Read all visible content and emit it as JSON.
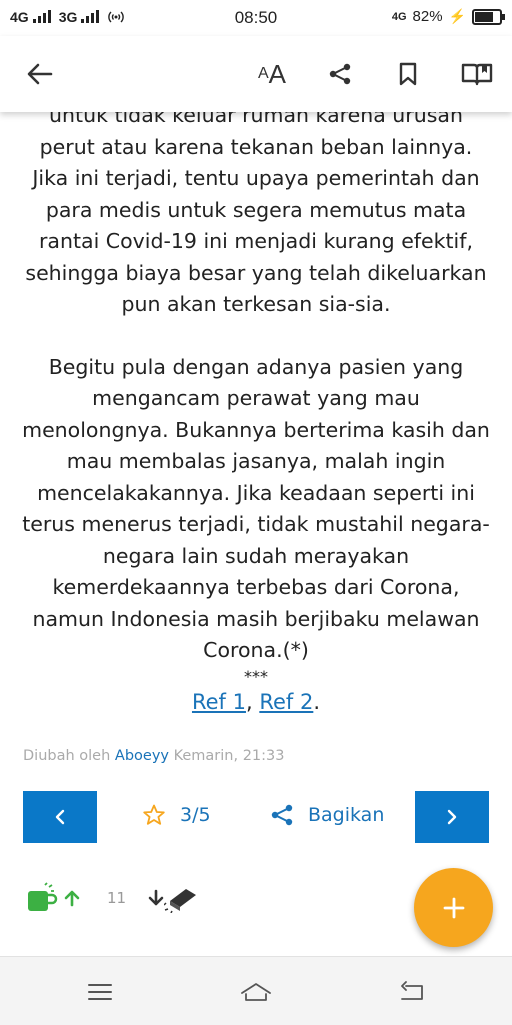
{
  "status_bar": {
    "network_1": "4G",
    "network_2": "3G",
    "time": "08:50",
    "network_right": "4G",
    "battery_percent": "82%",
    "battery_level": 0.82
  },
  "toolbar": {
    "text_size_small": "A",
    "text_size_big": "A",
    "icons": [
      "back-arrow-icon",
      "text-size-icon",
      "share-icon",
      "bookmark-icon",
      "book-icon"
    ]
  },
  "article": {
    "paragraph_1": "untuk tidak keluar rumah karena urusan perut atau karena tekanan beban lainnya. Jika ini terjadi, tentu upaya pemerintah dan para medis untuk segera memutus mata rantai Covid-19 ini menjadi kurang efektif, sehingga biaya besar yang telah dikeluarkan pun akan terkesan sia-sia.",
    "paragraph_2": "Begitu pula dengan adanya pasien yang mengancam perawat yang mau menolongnya. Bukannya berterima kasih dan mau membalas jasanya, malah ingin mencelakakannya. Jika keadaan seperti ini terus menerus terjadi, tidak mustahil negara-negara lain sudah merayakan kemerdekaannya terbebas dari Corona, namun Indonesia masih berjibaku melawan Corona.(*)",
    "separator": "***",
    "ref_1": "Ref 1",
    "ref_sep": ", ",
    "ref_2": "Ref 2",
    "ref_end": "."
  },
  "meta": {
    "prefix": "Diubah oleh",
    "author": "Aboeyy",
    "time": "Kemarin, 21:33"
  },
  "actions": {
    "prev_label": "<",
    "rating": "3/5",
    "share_label": "Bagikan",
    "next_label": ">"
  },
  "votes": {
    "count": "11"
  },
  "colors": {
    "accent": "#0a78c8",
    "link": "#1a73b8",
    "fab": "#f6a61e",
    "cendol_green": "#3cb043"
  }
}
